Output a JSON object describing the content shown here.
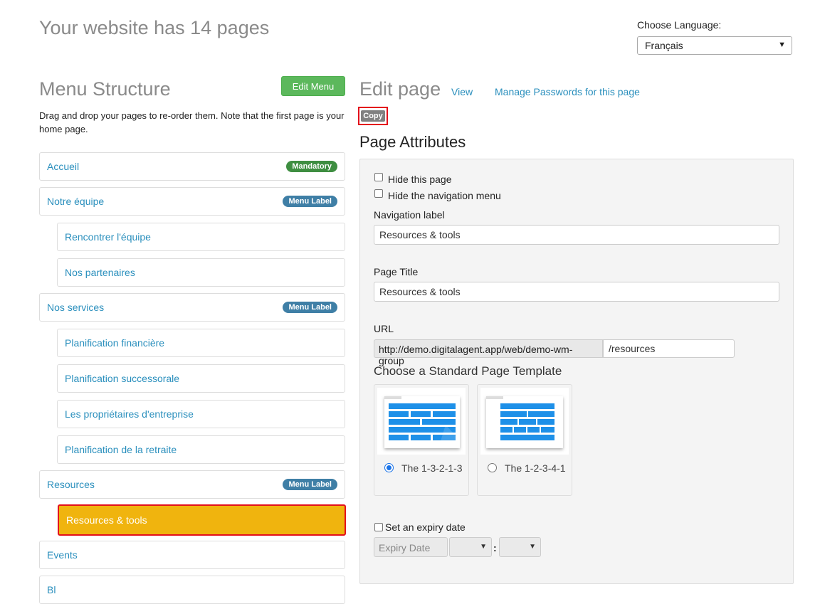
{
  "header": {
    "site_title": "Your website has 14 pages",
    "language_label": "Choose Language:",
    "language_value": "Français"
  },
  "menu": {
    "title": "Menu Structure",
    "edit_button": "Edit Menu",
    "description": "Drag and drop your pages to re-order them. Note that the first page is your home page.",
    "items": [
      {
        "label": "Accueil",
        "badge": "Mandatory"
      },
      {
        "label": "Notre équipe",
        "badge": "Menu Label"
      },
      {
        "label": "Rencontrer l'équipe"
      },
      {
        "label": "Nos partenaires"
      },
      {
        "label": "Nos services",
        "badge": "Menu Label"
      },
      {
        "label": "Planification financière"
      },
      {
        "label": "Planification successorale"
      },
      {
        "label": "Les propriétaires d'entreprise"
      },
      {
        "label": "Planification de la retraite"
      },
      {
        "label": "Resources",
        "badge": "Menu Label"
      },
      {
        "label": "Resources & tools"
      },
      {
        "label": "Events"
      },
      {
        "label": "Bl"
      }
    ]
  },
  "edit": {
    "title": "Edit page",
    "view_link": "View",
    "passwords_link": "Manage Passwords for this page",
    "copy_button": "Copy",
    "attributes_title": "Page Attributes",
    "hide_page_label": "Hide this page",
    "hide_nav_label": "Hide the navigation menu",
    "nav_label_label": "Navigation label",
    "nav_label_value": "Resources & tools",
    "page_title_label": "Page Title",
    "page_title_value": "Resources & tools",
    "url_label": "URL",
    "url_prefix": "http://demo.digitalagent.app/web/demo-wm-group",
    "url_slug": "/resources",
    "template_heading": "Choose a Standard Page Template",
    "templates": [
      {
        "label": "The 1-3-2-1-3",
        "selected": true
      },
      {
        "label": "The 1-2-3-4-1",
        "selected": false
      }
    ],
    "expiry_label": "Set an expiry date",
    "expiry_placeholder": "Expiry Date",
    "time_separator": ":"
  },
  "colors": {
    "link": "#2a8fbd",
    "active_item": "#f0b40e",
    "highlight_border": "#e3101b",
    "edit_menu_button": "#5cb85c"
  }
}
